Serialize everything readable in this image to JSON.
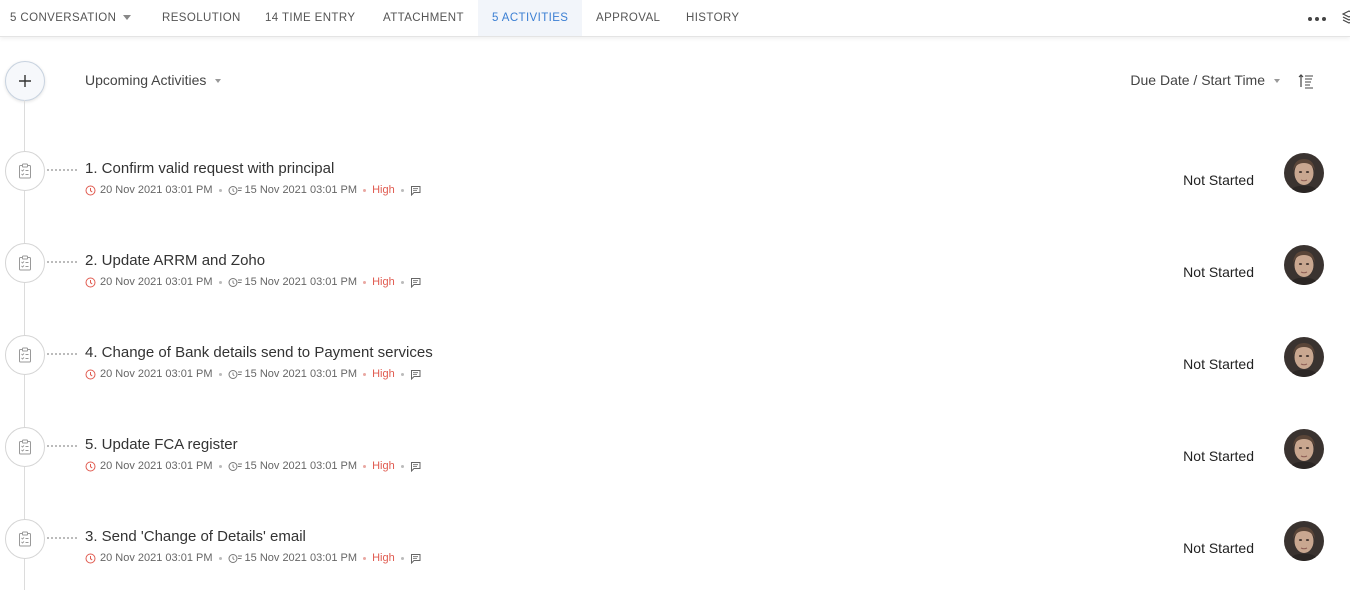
{
  "tabs": [
    {
      "label": "5 CONVERSATION",
      "has_dropdown": true
    },
    {
      "label": "RESOLUTION"
    },
    {
      "label": "14 TIME ENTRY"
    },
    {
      "label": "ATTACHMENT"
    },
    {
      "label": "5 ACTIVITIES",
      "active": true
    },
    {
      "label": "APPROVAL"
    },
    {
      "label": "HISTORY"
    }
  ],
  "toolbar": {
    "filter_label": "Upcoming Activities",
    "sort_label": "Due Date / Start Time"
  },
  "colors": {
    "accent": "#3b7fd3",
    "priority_high": "#e05a4f"
  },
  "activities": [
    {
      "title": "1. Confirm valid request with principal",
      "due": "20 Nov 2021 03:01 PM",
      "start": "15 Nov 2021 03:01 PM",
      "priority": "High",
      "status": "Not Started"
    },
    {
      "title": "2. Update ARRM and Zoho",
      "due": "20 Nov 2021 03:01 PM",
      "start": "15 Nov 2021 03:01 PM",
      "priority": "High",
      "status": "Not Started"
    },
    {
      "title": "4. Change of Bank details send to Payment services",
      "due": "20 Nov 2021 03:01 PM",
      "start": "15 Nov 2021 03:01 PM",
      "priority": "High",
      "status": "Not Started"
    },
    {
      "title": "5. Update FCA register",
      "due": "20 Nov 2021 03:01 PM",
      "start": "15 Nov 2021 03:01 PM",
      "priority": "High",
      "status": "Not Started"
    },
    {
      "title": "3. Send 'Change of Details' email",
      "due": "20 Nov 2021 03:01 PM",
      "start": "15 Nov 2021 03:01 PM",
      "priority": "High",
      "status": "Not Started"
    }
  ]
}
